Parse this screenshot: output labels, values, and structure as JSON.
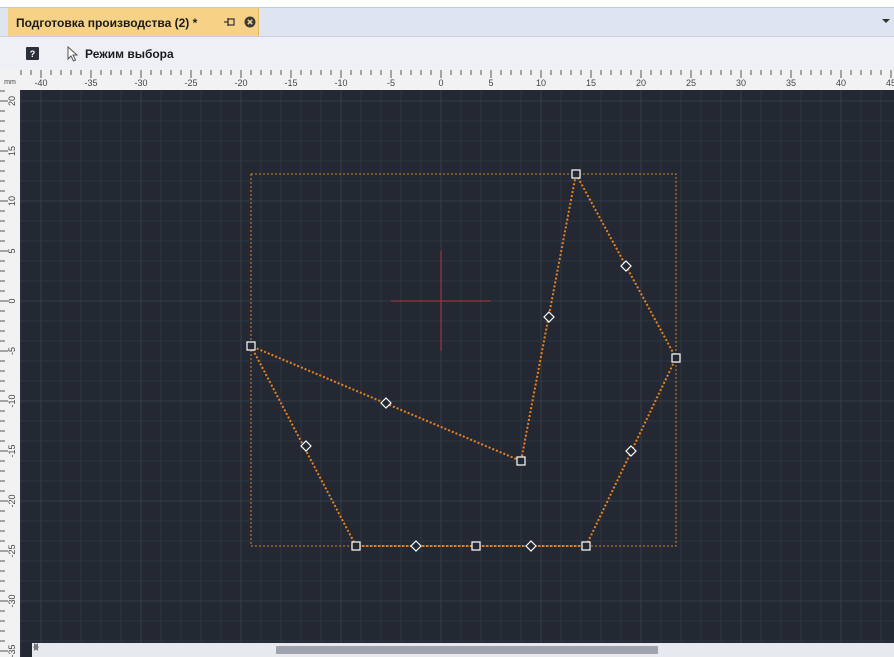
{
  "tab": {
    "title": "Подготовка производства (2) *",
    "pin_icon": "pin-icon",
    "close_icon": "close-icon"
  },
  "toolbar": {
    "help_label": "?",
    "select_mode_label": "Режим выбора",
    "select_mode_icon": "cursor-arrow-icon"
  },
  "canvas": {
    "unit_label": "mm",
    "x_ticks": [
      "-40",
      "-35",
      "-30",
      "-25",
      "-20",
      "-15",
      "-10",
      "-5",
      "0",
      "5",
      "10",
      "15",
      "20",
      "25",
      "30",
      "35",
      "40",
      "45"
    ],
    "y_ticks": [
      "20",
      "15",
      "10",
      "5",
      "0",
      "-5",
      "-10",
      "-15",
      "-20",
      "-25",
      "-30",
      "-35"
    ],
    "colors": {
      "background": "#232833",
      "grid": "#2e3440",
      "shape_line": "#e8821e",
      "bounding_box": "#c98a2a",
      "origin_cross": "#b33a3a",
      "ruler_bg": "#f2f2f2"
    },
    "shape_vertices_mm": [
      [
        13.5,
        12.7
      ],
      [
        23.5,
        -5.7
      ],
      [
        14.5,
        -24.5
      ],
      [
        -8.5,
        -24.5
      ],
      [
        -19,
        -4.5
      ],
      [
        8,
        -16
      ],
      [
        13.5,
        12.7
      ]
    ],
    "shape_midpoints_mm": [
      [
        18.5,
        3.5
      ],
      [
        19,
        -15
      ],
      [
        9,
        -24.5
      ],
      [
        -2.5,
        -24.5
      ],
      [
        -13.5,
        -14.5
      ],
      [
        -5.5,
        -10.2
      ],
      [
        10.8,
        -1.6
      ]
    ],
    "extra_vertex_mm": [
      3.5,
      -24.5
    ],
    "bounding_box_mm": {
      "x_min": -19,
      "x_max": 23.5,
      "y_min": -24.5,
      "y_max": 12.7
    }
  }
}
